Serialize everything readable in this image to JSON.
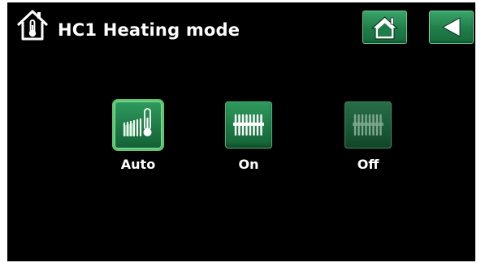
{
  "header": {
    "title": "HC1 Heating mode",
    "title_icon": "house-thermometer-icon",
    "buttons": [
      {
        "name": "home",
        "icon": "home-icon"
      },
      {
        "name": "back",
        "icon": "back-arrow-icon"
      }
    ]
  },
  "modes": [
    {
      "label": "Auto",
      "icon": "radiator-thermometer-icon",
      "selected": true
    },
    {
      "label": "On",
      "icon": "radiator-icon",
      "selected": false
    },
    {
      "label": "Off",
      "icon": "radiator-off-icon",
      "selected": false
    }
  ],
  "colors": {
    "background": "#000000",
    "button_green": "#1f7d49",
    "selected_outline": "#5fc46b",
    "text": "#ffffff"
  }
}
